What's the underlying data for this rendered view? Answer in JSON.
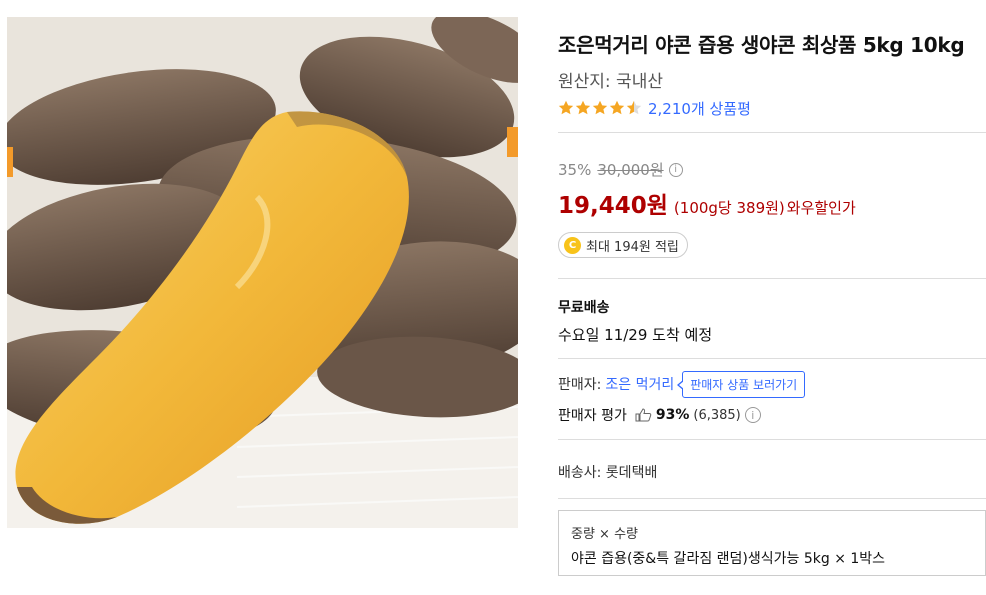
{
  "product": {
    "title": "조은먹거리 야콘 즙용 생야콘 최상품 5kg 10kg",
    "origin": "원산지: 국내산",
    "rating_value": 4.5,
    "review_count_text": "2,210개 상품평"
  },
  "price": {
    "discount": "35%",
    "original": "30,000원",
    "info_icon": "i",
    "sale": "19,440원",
    "unit": "(100g당 389원)",
    "wow": "와우할인가"
  },
  "reward": {
    "coin_symbol": "C",
    "text": "최대 194원 적립"
  },
  "shipping": {
    "title": "무료배송",
    "arrival": "수요일 11/29 도착 예정"
  },
  "seller": {
    "label": "판매자:",
    "name": "조은 먹거리",
    "button": "판매자 상품 보러가기",
    "eval_label": "판매자 평가",
    "eval_pct": "93%",
    "eval_count": "(6,385)",
    "info_icon": "i"
  },
  "carrier": "배송사: 롯데택배",
  "option": {
    "header": "중량 × 수량",
    "value": "야콘 즙용(중&특 갈라짐 랜덤)생식가능 5kg × 1박스"
  },
  "colors": {
    "accent": "#346aff",
    "sale_red": "#ae0000",
    "star": "#f5a623",
    "coin": "#f8c31a"
  }
}
